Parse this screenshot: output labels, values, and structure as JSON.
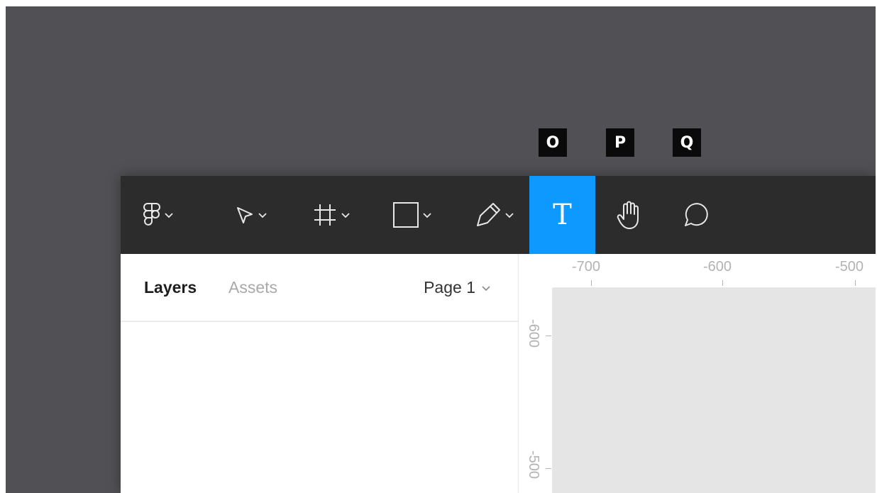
{
  "shortcuts": [
    "O",
    "P",
    "Q"
  ],
  "toolbar": {
    "tools": [
      {
        "name": "main-menu",
        "icon": "figma-logo-icon",
        "has_dropdown": true
      },
      {
        "name": "move-tool",
        "icon": "move-cursor-icon",
        "has_dropdown": true
      },
      {
        "name": "frame-tool",
        "icon": "frame-hash-icon",
        "has_dropdown": true
      },
      {
        "name": "shape-tool",
        "icon": "rectangle-icon",
        "has_dropdown": true
      },
      {
        "name": "pen-tool",
        "icon": "pen-icon",
        "has_dropdown": true
      },
      {
        "name": "text-tool",
        "icon": "text-icon",
        "label": "T",
        "active": true
      },
      {
        "name": "hand-tool",
        "icon": "hand-icon"
      },
      {
        "name": "comment-tool",
        "icon": "comment-bubble-icon"
      }
    ],
    "active_color": "#0d99ff",
    "background": "#2c2c2c"
  },
  "left_panel": {
    "tabs": [
      {
        "label": "Layers",
        "active": true
      },
      {
        "label": "Assets",
        "active": false
      }
    ],
    "page_selector": "Page 1"
  },
  "rulers": {
    "top_labels": [
      "-700",
      "-600",
      "-500"
    ],
    "left_labels": [
      "-600",
      "-500"
    ]
  },
  "colors": {
    "backdrop": "#515055",
    "canvas": "#e5e5e5"
  }
}
